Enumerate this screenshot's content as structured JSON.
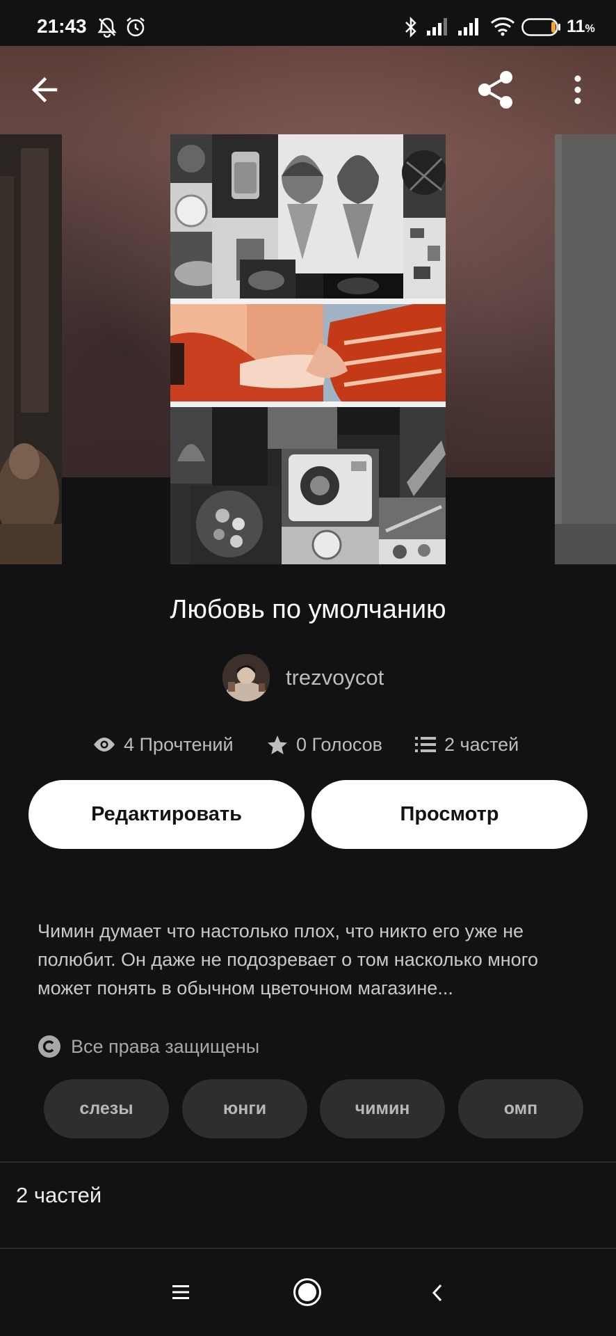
{
  "status_bar": {
    "time": "21:43",
    "battery": "11",
    "battery_unit": "%",
    "icons": [
      "bell-off-icon",
      "alarm-icon",
      "bluetooth-icon",
      "signal-icon",
      "signal-icon",
      "wifi-icon",
      "battery-icon"
    ]
  },
  "toolbar": {
    "back_icon": "arrow-left-icon",
    "share_icon": "share-icon",
    "more_icon": "more-vertical-icon"
  },
  "story": {
    "title": "Любовь по умолчанию",
    "author": "trezvoycot",
    "reads": "4 Прочтений",
    "votes": "0 Голосов",
    "parts": "2 частей",
    "description": "Чимин думает что настолько плох, что никто его уже не полюбит. Он даже не подозревает о том насколько много может понять в обычном цветочном магазине...",
    "copyright": "Все права защищены",
    "tags": [
      "слезы",
      "юнги",
      "чимин",
      "омп"
    ]
  },
  "actions": {
    "edit_label": "Редактировать",
    "view_label": "Просмотр"
  },
  "parts_section": {
    "label": "2 частей"
  },
  "navigation": {
    "recents_icon": "menu-icon",
    "home_icon": "home-circle-icon",
    "back_icon": "chevron-left-icon"
  },
  "colors": {
    "background": "#121113",
    "button_bg": "#ffffff",
    "tag_bg": "#2e2d30",
    "secondary_text": "#bdbdbd"
  }
}
